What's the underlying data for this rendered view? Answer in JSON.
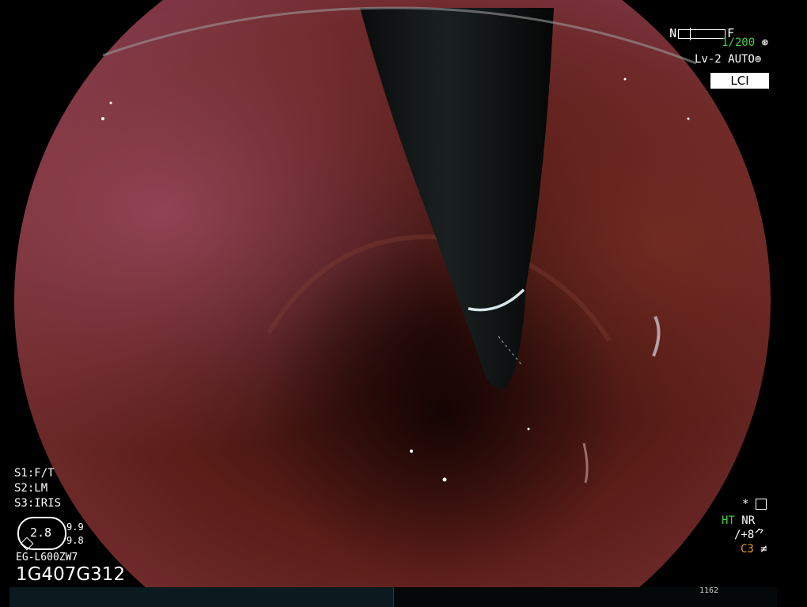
{
  "overlay_top_right": {
    "orientation_left": "N",
    "orientation_right": "F",
    "zoom_ratio": "1/200",
    "level_mode": "Lv-2 AUTO",
    "mode_badge": "LCI"
  },
  "overlay_bottom_left": {
    "s1": "S1:F/T",
    "s2": "S2:LM",
    "s3": "S3:IRIS",
    "dial_value": "2.8",
    "dial_upper": "9.9",
    "dial_lower": "9.8",
    "scope_model": "EG-L600ZW7",
    "serial": "1G407G312"
  },
  "overlay_bottom_right": {
    "star_item": "*",
    "ht": "HT",
    "nr": "NR",
    "enhance": "/+8",
    "color": "C3"
  },
  "bottom_bar": {
    "counter": "1162"
  },
  "colors": {
    "status_green": "#3fd23f",
    "status_orange": "#e0a030",
    "mucosa_dark": "#3a1410",
    "mucosa_light": "#8a3a3a"
  },
  "icons": [
    "hold-icon",
    "auto-icon",
    "freeze-icon",
    "flip-icon",
    "filter-icon"
  ]
}
